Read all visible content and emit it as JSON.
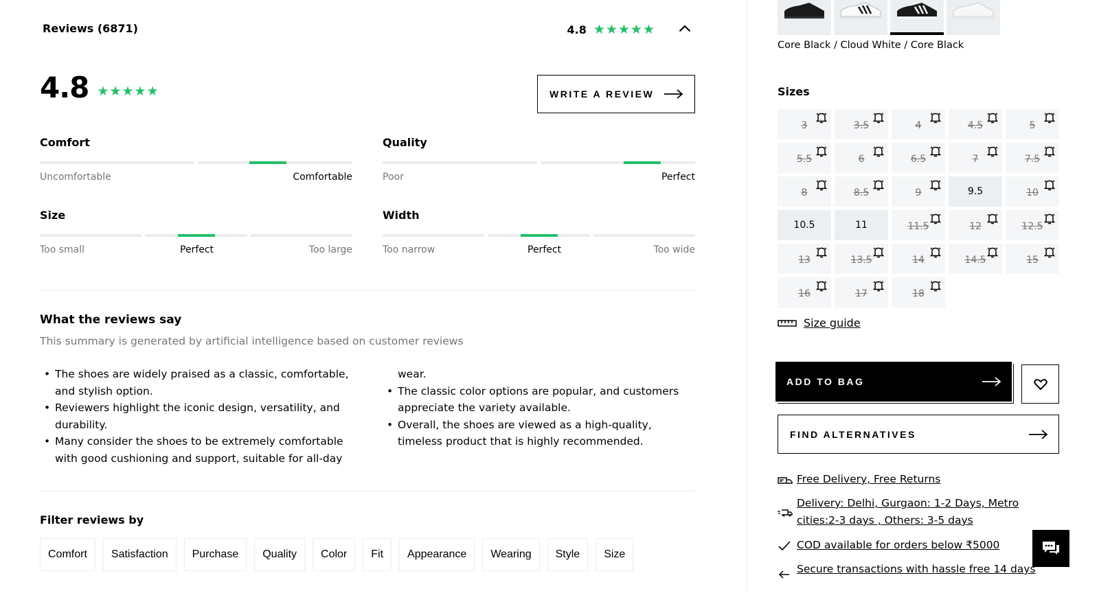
{
  "reviews": {
    "title": "Reviews (6871)",
    "rating": "4.8",
    "stars": "★★★★★",
    "write_review_label": "WRITE A REVIEW",
    "meters": {
      "comfort": {
        "title": "Comfort",
        "labels": [
          "Uncomfortable",
          "Comfortable"
        ],
        "value": 0.73
      },
      "quality": {
        "title": "Quality",
        "labels": [
          "Poor",
          "Perfect"
        ],
        "value": 0.83
      },
      "size": {
        "title": "Size",
        "labels": [
          "Too small",
          "Perfect",
          "Too large"
        ],
        "value": 0.5
      },
      "width": {
        "title": "Width",
        "labels": [
          "Too narrow",
          "Perfect",
          "Too wide"
        ],
        "value": 0.5
      }
    },
    "summary": {
      "title": "What the reviews say",
      "subtitle": "This summary is generated by artificial intelligence based on customer reviews",
      "bullets": [
        "The shoes are widely praised as a classic, comfortable, and stylish option.",
        "Reviewers highlight the iconic design, versatility, and durability.",
        "Many consider the shoes to be extremely comfortable with good cushioning and support, suitable for all-day wear.",
        "The classic color options are popular, and customers appreciate the variety available.",
        "Overall, the shoes are viewed as a high-quality, timeless product that is highly recommended."
      ]
    },
    "filter": {
      "title": "Filter reviews by",
      "chips": [
        "Comfort",
        "Satisfaction",
        "Purchase",
        "Quality",
        "Color",
        "Fit",
        "Appearance",
        "Wearing",
        "Style",
        "Size"
      ]
    }
  },
  "product": {
    "color_name": "Core Black / Cloud White / Core Black",
    "sizes_title": "Sizes",
    "sizes": [
      {
        "label": "3",
        "available": false
      },
      {
        "label": "3.5",
        "available": false
      },
      {
        "label": "4",
        "available": false
      },
      {
        "label": "4.5",
        "available": false
      },
      {
        "label": "5",
        "available": false
      },
      {
        "label": "5.5",
        "available": false
      },
      {
        "label": "6",
        "available": false
      },
      {
        "label": "6.5",
        "available": false
      },
      {
        "label": "7",
        "available": false
      },
      {
        "label": "7.5",
        "available": false
      },
      {
        "label": "8",
        "available": false
      },
      {
        "label": "8.5",
        "available": false
      },
      {
        "label": "9",
        "available": false
      },
      {
        "label": "9.5",
        "available": true
      },
      {
        "label": "10",
        "available": false
      },
      {
        "label": "10.5",
        "available": true
      },
      {
        "label": "11",
        "available": true
      },
      {
        "label": "11.5",
        "available": false
      },
      {
        "label": "12",
        "available": false
      },
      {
        "label": "12.5",
        "available": false
      },
      {
        "label": "13",
        "available": false
      },
      {
        "label": "13.5",
        "available": false
      },
      {
        "label": "14",
        "available": false
      },
      {
        "label": "14.5",
        "available": false
      },
      {
        "label": "15",
        "available": false
      },
      {
        "label": "16",
        "available": false
      },
      {
        "label": "17",
        "available": false
      },
      {
        "label": "18",
        "available": false
      }
    ],
    "size_guide_label": "Size guide",
    "add_to_bag_label": "ADD TO BAG",
    "find_alternatives_label": "FIND ALTERNATIVES",
    "perks": {
      "free_delivery": "Free Delivery, Free Returns",
      "delivery_times": "Delivery: Delhi, Gurgaon: 1-2 Days, Metro cities:2-3 days , Others: 3-5 days",
      "cod": "COD available for orders below ₹5000",
      "secure": "Secure transactions with hassle free 14 days"
    }
  }
}
